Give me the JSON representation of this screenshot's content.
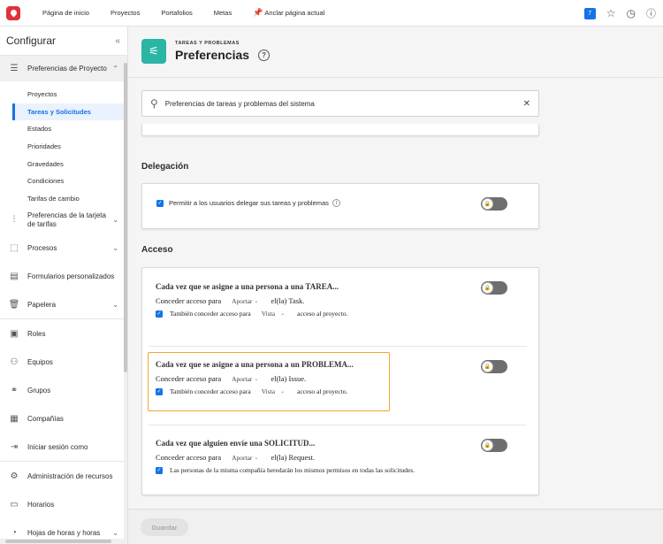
{
  "topbar": {
    "nav": [
      "Página de inicio",
      "Proyectos",
      "Portafolios",
      "Metas"
    ],
    "pin_label": "Anclar página actual",
    "notifications_count": "7"
  },
  "sidebar": {
    "title": "Configurar",
    "groups": [
      {
        "label": "Preferencias de Proyecto"
      },
      {
        "label": "Preferencias de la tarjeta de tarifas"
      },
      {
        "label": "Procesos"
      },
      {
        "label": "Formularios personalizados"
      },
      {
        "label": "Papelera"
      },
      {
        "label": "Roles"
      },
      {
        "label": "Equipos"
      },
      {
        "label": "Grupos"
      },
      {
        "label": "Compañías"
      },
      {
        "label": "Iniciar sesión como"
      },
      {
        "label": "Administración de recursos"
      },
      {
        "label": "Horarios"
      },
      {
        "label": "Hojas de horas y horas"
      }
    ],
    "sub_items": [
      "Proyectos",
      "Tareas y Solicitudes",
      "Estados",
      "Prioridades",
      "Gravedades",
      "Condiciones",
      "Tarifas de cambio"
    ]
  },
  "page": {
    "kicker": "TAREAS Y PROBLEMAS",
    "title": "Preferencias",
    "help": "?"
  },
  "search": {
    "value": "Preferencias de tareas y problemas del sistema"
  },
  "delegacion": {
    "heading": "Delegación",
    "checkbox_label": "Permitir a los usuarios delegar sus tareas y problemas"
  },
  "acceso": {
    "heading": "Acceso",
    "rows": [
      {
        "title": "Cada vez que se asigne a una persona a una TAREA...",
        "grant_label": "Conceder acceso para",
        "grant_value": "Aportar",
        "target": "el(la) Task.",
        "also_label": "También conceder acceso para",
        "also_value": "Vista",
        "also_suffix": "acceso al proyecto."
      },
      {
        "title": "Cada vez que se asigne a una persona a un PROBLEMA...",
        "grant_label": "Conceder acceso para",
        "grant_value": "Aportar",
        "target": "el(la) Issue.",
        "also_label": "También conceder acceso para",
        "also_value": "Vista",
        "also_suffix": "acceso al proyecto."
      },
      {
        "title": "Cada vez que alguien envíe una SOLICITUD...",
        "grant_label": "Conceder acceso para",
        "grant_value": "Aportar",
        "target": "el(la) Request.",
        "also_label": "Las personas de la misma compañía heredarán los mismos permisos en todas las solicitudes."
      }
    ]
  },
  "footer": {
    "save_label": "Guardar"
  },
  "colors": {
    "accent": "#1473e6",
    "page_icon": "#2ab5a5",
    "highlight": "#f0a530",
    "logo": "#e0333a"
  }
}
